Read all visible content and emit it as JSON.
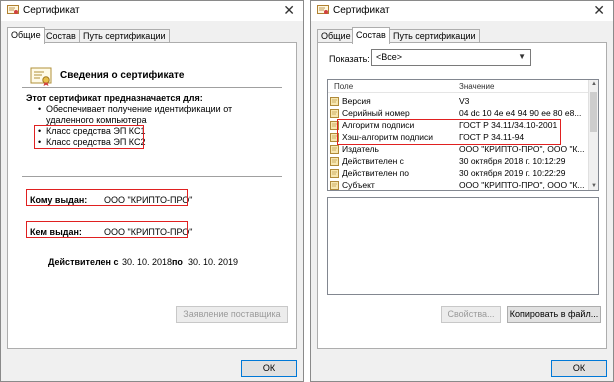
{
  "left": {
    "title": "Сертификат",
    "close": "✕",
    "tabs": [
      "Общие",
      "Состав",
      "Путь сертификации"
    ],
    "info_title": "Сведения о сертификате",
    "purpose_title": "Этот сертификат предназначается для:",
    "purposes": [
      "Обеспечивает получение идентификации от удаленного компьютера",
      "Класс средства ЭП КС1",
      "Класс средства ЭП КС2"
    ],
    "issued_to_label": "Кому выдан:",
    "issued_to_value": "ООО \"КРИПТО-ПРО\"",
    "issued_by_label": "Кем выдан:",
    "issued_by_value": "ООО \"КРИПТО-ПРО\"",
    "valid_from_label": "Действителен с",
    "valid_from": "30. 10. 2018",
    "valid_to_label": "по",
    "valid_to": "30. 10. 2019",
    "issuer_statement_button": "Заявление поставщика",
    "ok_button": "ОК"
  },
  "right": {
    "title": "Сертификат",
    "close": "✕",
    "tabs": [
      "Общие",
      "Состав",
      "Путь сертификации"
    ],
    "show_label": "Показать:",
    "show_value": "<Все>",
    "columns": [
      "Поле",
      "Значение"
    ],
    "rows": [
      {
        "field": "Версия",
        "value": "V3"
      },
      {
        "field": "Серийный номер",
        "value": "04 dc 10 4e e4 94 90 ee 80 e8..."
      },
      {
        "field": "Алгоритм подписи",
        "value": "ГОСТ Р 34.11/34.10-2001"
      },
      {
        "field": "Хэш-алгоритм подписи",
        "value": "ГОСТ Р 34.11-94"
      },
      {
        "field": "Издатель",
        "value": "ООО \"КРИПТО-ПРО\", ООО \"К..."
      },
      {
        "field": "Действителен с",
        "value": "30 октября 2018 г. 10:12:29"
      },
      {
        "field": "Действителен по",
        "value": "30 октября 2019 г. 10:22:29"
      },
      {
        "field": "Субъект",
        "value": "ООО \"КРИПТО-ПРО\", ООО \"К..."
      }
    ],
    "properties_button": "Свойства...",
    "copy_button": "Копировать в файл...",
    "ok_button": "ОК"
  },
  "colors": {
    "highlight": "#e02020",
    "focus": "#0078d7"
  }
}
